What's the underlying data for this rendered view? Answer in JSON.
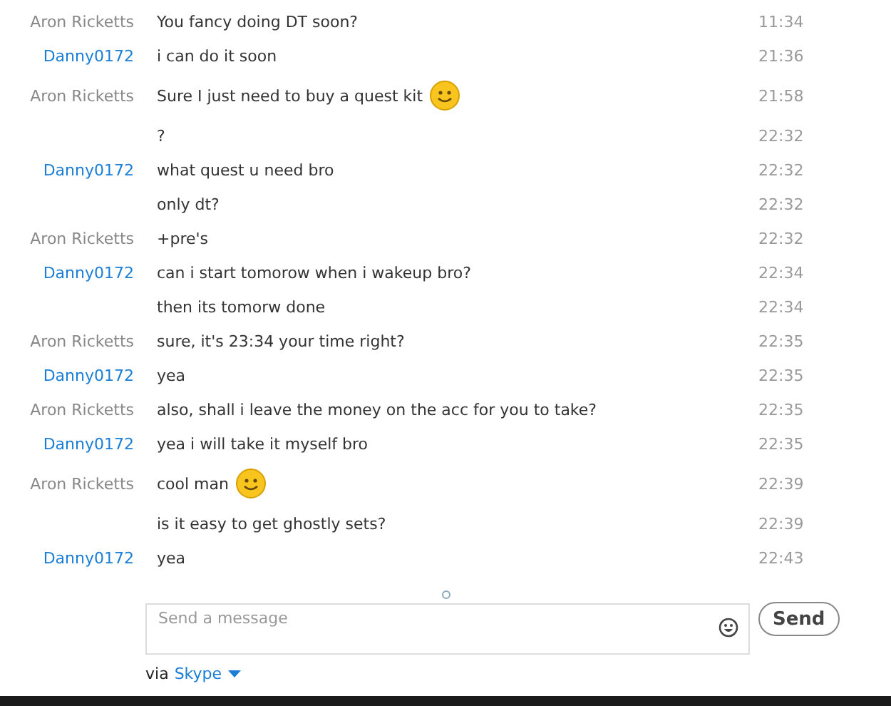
{
  "messages": [
    {
      "sender": "Aron Ricketts",
      "kind": "other",
      "text": "You fancy doing DT soon?",
      "time": "11:34",
      "emoji": false
    },
    {
      "sender": "Danny0172",
      "kind": "self",
      "text": "i can do it soon",
      "time": "21:36",
      "emoji": false
    },
    {
      "sender": "Aron Ricketts",
      "kind": "other",
      "text": "Sure I just need to buy a quest kit",
      "time": "21:58",
      "emoji": true
    },
    {
      "text": "?",
      "time": "22:32",
      "emoji": false
    },
    {
      "sender": "Danny0172",
      "kind": "self",
      "text": "what quest u need bro",
      "time": "22:32",
      "emoji": false
    },
    {
      "text": "only dt?",
      "time": "22:32",
      "emoji": false
    },
    {
      "sender": "Aron Ricketts",
      "kind": "other",
      "text": "+pre's",
      "time": "22:32",
      "emoji": false
    },
    {
      "sender": "Danny0172",
      "kind": "self",
      "text": "can i start tomorow when i wakeup bro?",
      "time": "22:34",
      "emoji": false
    },
    {
      "text": "then its tomorw done",
      "time": "22:34",
      "emoji": false
    },
    {
      "sender": "Aron Ricketts",
      "kind": "other",
      "text": "sure, it's 23:34 your time right?",
      "time": "22:35",
      "emoji": false
    },
    {
      "sender": "Danny0172",
      "kind": "self",
      "text": "yea",
      "time": "22:35",
      "emoji": false
    },
    {
      "sender": "Aron Ricketts",
      "kind": "other",
      "text": "also, shall i leave the money on the acc for you to take?",
      "time": "22:35",
      "emoji": false
    },
    {
      "sender": "Danny0172",
      "kind": "self",
      "text": "yea i will take it myself bro",
      "time": "22:35",
      "emoji": false
    },
    {
      "sender": "Aron Ricketts",
      "kind": "other",
      "text": "cool man",
      "time": "22:39",
      "emoji": true
    },
    {
      "text": "is it easy to get ghostly sets?",
      "time": "22:39",
      "emoji": false
    },
    {
      "sender": "Danny0172",
      "kind": "self",
      "text": "yea",
      "time": "22:43",
      "emoji": false
    }
  ],
  "composer": {
    "placeholder": "Send a message",
    "send": "Send"
  },
  "footer": {
    "via": "via",
    "network": "Skype"
  }
}
